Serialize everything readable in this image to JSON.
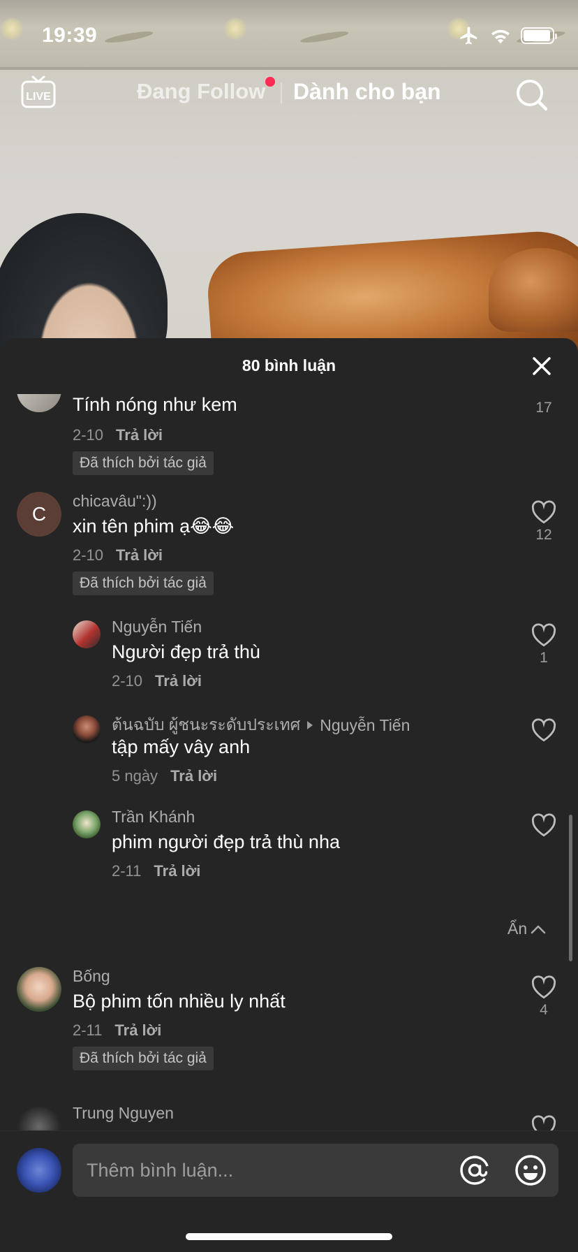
{
  "status_bar": {
    "time": "19:39"
  },
  "top_nav": {
    "live_label": "LIVE",
    "tab_following": "Đang Follow",
    "tab_for_you": "Dành cho bạn"
  },
  "sheet": {
    "title": "80 bình luận",
    "comments": [
      {
        "text": "Tính nóng như kem",
        "date": "2-10",
        "reply": "Trả lời",
        "badge": "Đã thích bởi tác giả",
        "likes": "17"
      },
      {
        "avatar_letter": "C",
        "username": "chicavâu\":))",
        "text": "xin tên phim ạ😂😂",
        "date": "2-10",
        "reply": "Trả lời",
        "badge": "Đã thích bởi tác giả",
        "likes": "12"
      },
      {
        "username": "Nguyễn Tiến",
        "text": "Người đẹp trả thù",
        "date": "2-10",
        "reply": "Trả lời",
        "likes": "1"
      },
      {
        "username": "ต้นฉบับ ผู้ชนะระดับประเทศ",
        "reply_to": "Nguyễn Tiến",
        "text": "tập mấy vây anh",
        "date": "5 ngày",
        "reply": "Trả lời"
      },
      {
        "username": "Trần Khánh",
        "text": "phim người đẹp trả thù nha",
        "date": "2-11",
        "reply": "Trả lời"
      },
      {
        "username": "Bống",
        "text": "Bộ phim tốn nhiều ly nhất",
        "date": "2-11",
        "reply": "Trả lời",
        "badge": "Đã thích bởi tác giả",
        "likes": "4"
      },
      {
        "username": "Trung Nguyen"
      }
    ],
    "collapse_label": "Ẩn"
  },
  "input": {
    "placeholder": "Thêm bình luận..."
  },
  "colors": {
    "sheet_bg": "#252525",
    "accent_dot": "#fe2c55"
  },
  "icons": [
    "live-icon",
    "search-icon",
    "close-icon",
    "heart-icon",
    "at-icon",
    "emoji-icon",
    "airplane-icon",
    "wifi-icon",
    "battery-icon",
    "chevron-up-icon",
    "caret-right-icon"
  ]
}
